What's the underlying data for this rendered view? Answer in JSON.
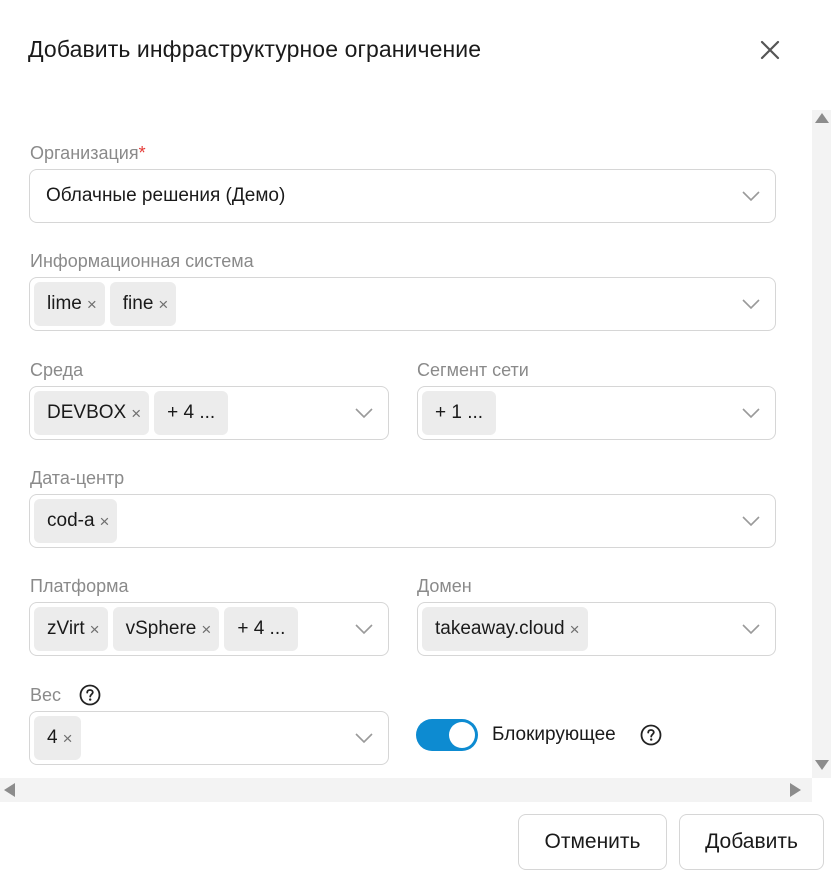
{
  "dialog": {
    "title": "Добавить инфраструктурное ограничение"
  },
  "form": {
    "organization": {
      "label": "Организация",
      "required_mark": "*",
      "value": "Облачные решения (Демо)"
    },
    "info_system": {
      "label": "Информационная система",
      "chips": [
        "lime",
        "fine"
      ]
    },
    "environment": {
      "label": "Среда",
      "chips": [
        "DEVBOX"
      ],
      "more": "+ 4 ..."
    },
    "network_segment": {
      "label": "Сегмент сети",
      "more": "+ 1 ..."
    },
    "datacenter": {
      "label": "Дата-центр",
      "chips": [
        "cod-a"
      ]
    },
    "platform": {
      "label": "Платформа",
      "chips": [
        "zVirt",
        "vSphere"
      ],
      "more": "+ 4 ..."
    },
    "domain": {
      "label": "Домен",
      "chips": [
        "takeaway.cloud"
      ]
    },
    "weight": {
      "label": "Вес",
      "chips": [
        "4"
      ],
      "help_icon": "question-circle-icon"
    },
    "blocking": {
      "label": "Блокирующее",
      "checked": true,
      "help_icon": "question-circle-icon",
      "toggle_color": "#0d8bd1"
    }
  },
  "icons": {
    "close": "close-icon",
    "chevron": "chevron-down-icon",
    "remove": "×"
  },
  "footer": {
    "cancel_label": "Отменить",
    "add_label": "Добавить"
  }
}
